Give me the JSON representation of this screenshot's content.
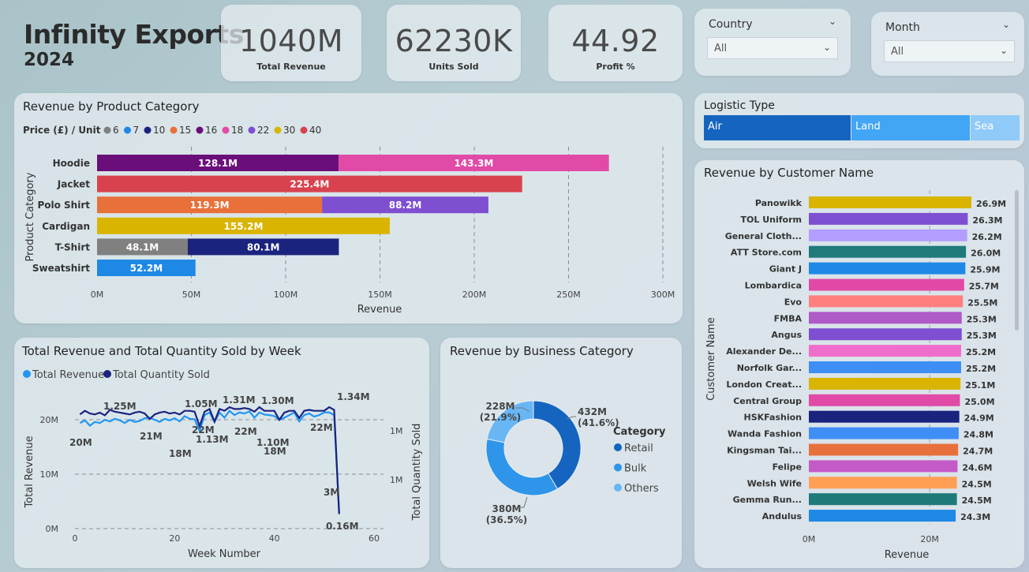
{
  "header": {
    "title": "Infinity Exports",
    "year": "2024"
  },
  "kpis": [
    {
      "value": "1040M",
      "label": "Total Revenue"
    },
    {
      "value": "62230K",
      "label": "Units Sold"
    },
    {
      "value": "44.92",
      "label": "Profit %"
    }
  ],
  "slicers": {
    "country": {
      "label": "Country",
      "value": "All"
    },
    "month": {
      "label": "Month",
      "value": "All"
    }
  },
  "logistic": {
    "title": "Logistic Type",
    "options": [
      "Air",
      "Land",
      "Sea"
    ],
    "colors": [
      "#1565c0",
      "#42a5f5",
      "#90caf9"
    ]
  },
  "chart_data": [
    {
      "type": "bar",
      "title": "Revenue by Product Category",
      "orientation": "horizontal-stacked",
      "legend_title": "Price (£) / Unit",
      "legend": [
        {
          "name": "6",
          "color": "#808080"
        },
        {
          "name": "7",
          "color": "#1e88e5"
        },
        {
          "name": "10",
          "color": "#1a237e"
        },
        {
          "name": "15",
          "color": "#e8703a"
        },
        {
          "name": "16",
          "color": "#6a0f7a"
        },
        {
          "name": "18",
          "color": "#e14aa6"
        },
        {
          "name": "22",
          "color": "#7e4fd0"
        },
        {
          "name": "30",
          "color": "#d9b400"
        },
        {
          "name": "40",
          "color": "#d8424f"
        }
      ],
      "categories": [
        "Hoodie",
        "Jacket",
        "Polo Shirt",
        "Cardigan",
        "T-Shirt",
        "Sweatshirt"
      ],
      "segments": [
        [
          {
            "price": "16",
            "value": 128.1,
            "label": "128.1M"
          },
          {
            "price": "18",
            "value": 143.3,
            "label": "143.3M"
          }
        ],
        [
          {
            "price": "40",
            "value": 225.4,
            "label": "225.4M"
          }
        ],
        [
          {
            "price": "15",
            "value": 119.3,
            "label": "119.3M"
          },
          {
            "price": "22",
            "value": 88.2,
            "label": "88.2M"
          }
        ],
        [
          {
            "price": "30",
            "value": 155.2,
            "label": "155.2M"
          }
        ],
        [
          {
            "price": "6",
            "value": 48.1,
            "label": "48.1M"
          },
          {
            "price": "10",
            "value": 80.1,
            "label": "80.1M"
          }
        ],
        [
          {
            "price": "7",
            "value": 52.2,
            "label": "52.2M"
          }
        ]
      ],
      "xticks": [
        "0M",
        "50M",
        "100M",
        "150M",
        "200M",
        "250M",
        "300M"
      ],
      "xlim": [
        0,
        300
      ],
      "xlabel": "Revenue",
      "ylabel": "Product Category",
      "grid": true
    },
    {
      "type": "line",
      "title": "Total Revenue and Total Quantity Sold by Week",
      "series": [
        {
          "name": "Total Revenue",
          "color": "#2196f3"
        },
        {
          "name": "Total Quantity Sold",
          "color": "#1a237e"
        }
      ],
      "x": [
        1,
        2,
        3,
        4,
        5,
        6,
        7,
        8,
        9,
        10,
        11,
        12,
        13,
        14,
        15,
        16,
        17,
        18,
        19,
        20,
        21,
        22,
        23,
        24,
        25,
        26,
        27,
        28,
        29,
        30,
        31,
        32,
        33,
        34,
        35,
        36,
        37,
        38,
        39,
        40,
        41,
        42,
        43,
        44,
        45,
        46,
        47,
        48,
        49,
        50,
        51,
        52,
        53
      ],
      "revenue_m": [
        20,
        20.5,
        19.5,
        20.2,
        20,
        20.6,
        20.3,
        20.8,
        20.5,
        20,
        20.6,
        20.2,
        20.4,
        20.9,
        21,
        20.6,
        20.2,
        20.8,
        20.5,
        20.9,
        20.3,
        21.3,
        20.8,
        20.7,
        18.5,
        21.5,
        22,
        20.2,
        22,
        21,
        22.3,
        21.5,
        22,
        21.8,
        22.2,
        21,
        22,
        21.6,
        21.5,
        21.3,
        20.6,
        21,
        21.5,
        22,
        20.3,
        21.5,
        21.8,
        21.2,
        21.5,
        22,
        22,
        21.5,
        3
      ],
      "quantity_m": [
        1.26,
        1.3,
        1.27,
        1.26,
        1.28,
        1.25,
        1.31,
        1.29,
        1.28,
        1.27,
        1.26,
        1.28,
        1.29,
        1.27,
        1.21,
        1.26,
        1.28,
        1.29,
        1.27,
        1.28,
        1.26,
        1.3,
        1.3,
        1.29,
        1.13,
        1.29,
        1.32,
        1.18,
        1.32,
        1.3,
        1.34,
        1.32,
        1.32,
        1.33,
        1.32,
        1.29,
        1.34,
        1.3,
        1.3,
        1.3,
        1.2,
        1.28,
        1.3,
        1.3,
        1.22,
        1.3,
        1.31,
        1.3,
        1.3,
        1.3,
        1.34,
        1.31,
        0.16
      ],
      "annotations": [
        "1.25M",
        "1.05M",
        "1.31M",
        "1.30M",
        "1.34M",
        "20M",
        "21M",
        "22M",
        "18M",
        "1.13M",
        "22M",
        "1.10M",
        "18M",
        "22M",
        "3M",
        "0.16M"
      ],
      "xticks": [
        "0",
        "20",
        "40",
        "60"
      ],
      "xlim": [
        0,
        60
      ],
      "yticks_left": [
        "0M",
        "10M",
        "20M"
      ],
      "ylim_left": [
        0,
        24
      ],
      "yticks_right": [
        "1M",
        "1M"
      ],
      "xlabel": "Week Number",
      "ylabel": "Total Revenue",
      "ylabel_right": "Total Quantity Sold"
    },
    {
      "type": "pie",
      "title": "Revenue by Business Category",
      "legend_title": "Category",
      "categories": [
        "Retail",
        "Bulk",
        "Others"
      ],
      "values": [
        432,
        380,
        228
      ],
      "labels": [
        "432M",
        "380M",
        "228M"
      ],
      "percents": [
        "(41.6%)",
        "(36.5%)",
        "(21.9%)"
      ],
      "colors": [
        "#1565c0",
        "#2e95ea",
        "#69b6f5"
      ]
    },
    {
      "type": "bar",
      "title": "Revenue by Customer Name",
      "orientation": "horizontal",
      "categories": [
        "Panowikk",
        "TOL Uniform",
        "General Cloth...",
        "ATT Store.com",
        "Giant J",
        "Lombardica",
        "Evo",
        "FMBA",
        "Angus",
        "Alexander De...",
        "Norfolk Gar...",
        "London Creat...",
        "Central Group",
        "HSKFashion",
        "Wanda Fashion",
        "Kingsman Tai...",
        "Felipe",
        "Welsh Wife",
        "Gemma Run...",
        "Andulus"
      ],
      "values": [
        26.9,
        26.3,
        26.2,
        26.0,
        25.9,
        25.7,
        25.5,
        25.3,
        25.3,
        25.2,
        25.2,
        25.1,
        25.0,
        24.9,
        24.8,
        24.7,
        24.6,
        24.5,
        24.5,
        24.3
      ],
      "labels": [
        "26.9M",
        "26.3M",
        "26.2M",
        "26.0M",
        "25.9M",
        "25.7M",
        "25.5M",
        "25.3M",
        "25.3M",
        "25.2M",
        "25.2M",
        "25.1M",
        "25.0M",
        "24.9M",
        "24.8M",
        "24.7M",
        "24.6M",
        "24.5M",
        "24.5M",
        "24.3M"
      ],
      "colors": [
        "#d9b400",
        "#7e4fd0",
        "#b39dff",
        "#1f7a7a",
        "#1e88e5",
        "#e14aa6",
        "#ff7f7f",
        "#b05ac8",
        "#7e4fd0",
        "#f06ecb",
        "#3f8ef5",
        "#d9b400",
        "#e14aa6",
        "#1a237e",
        "#3f8ef5",
        "#e8703a",
        "#c45ac8",
        "#ff9f55",
        "#1f7a7a",
        "#1e88e5"
      ],
      "xticks": [
        "0M",
        "20M"
      ],
      "xlim": [
        0,
        30
      ],
      "xlabel": "Revenue",
      "ylabel": "Customer Name"
    }
  ]
}
